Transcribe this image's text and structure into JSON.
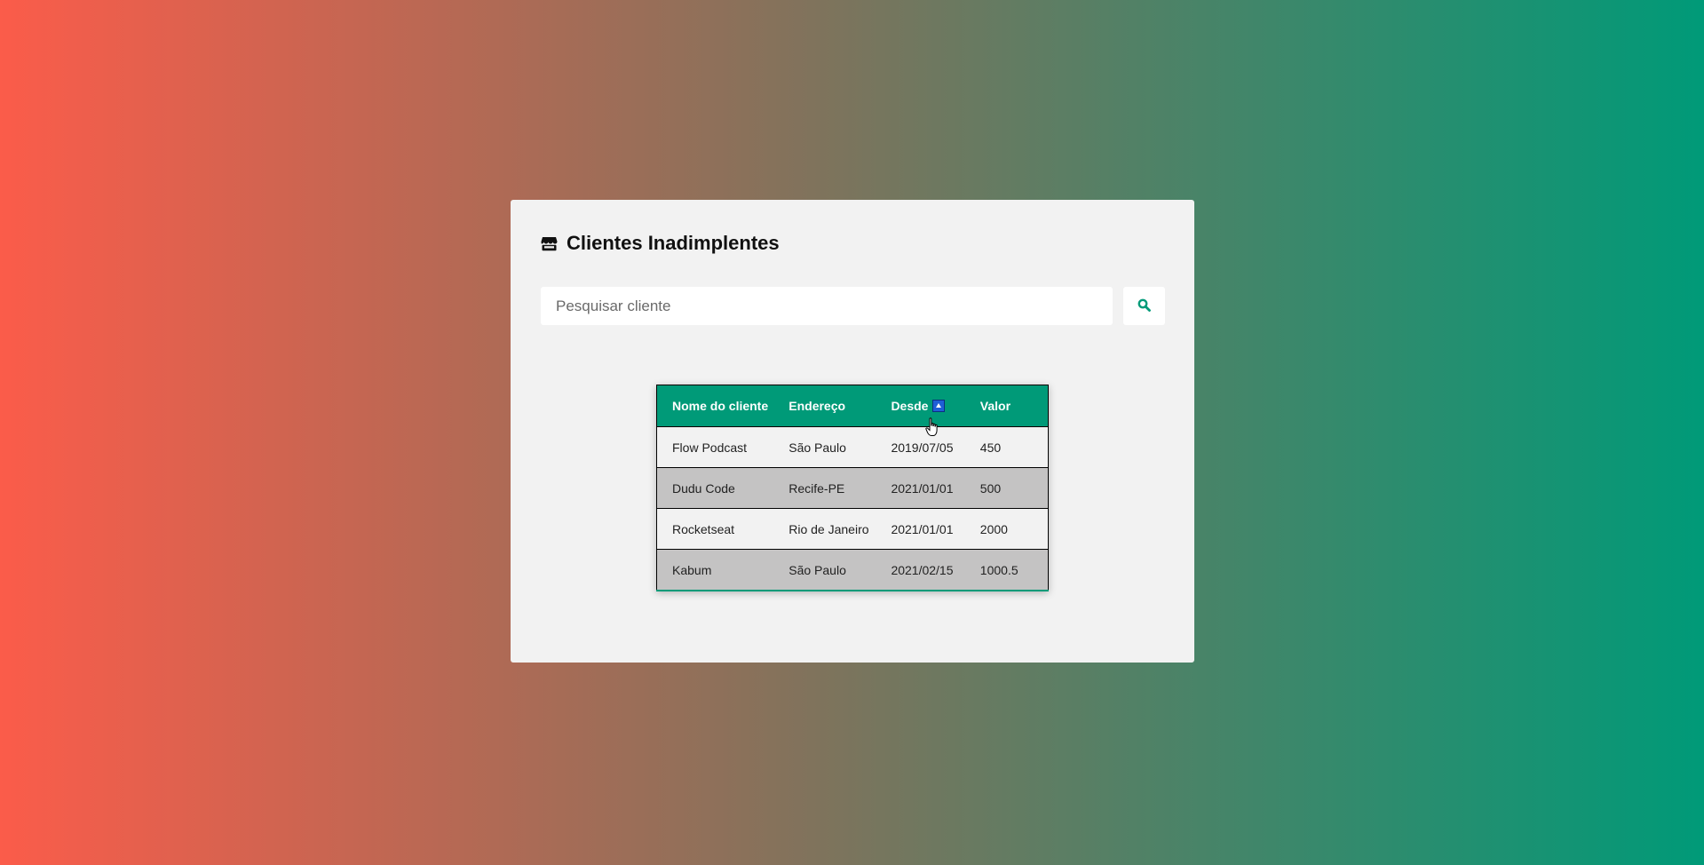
{
  "app": {
    "title": "Clientes Inadimplentes",
    "title_icon": "store-icon"
  },
  "search": {
    "placeholder": "Pesquisar cliente",
    "value": "",
    "button_icon": "search-icon"
  },
  "table": {
    "columns": [
      {
        "label": "Nome do cliente",
        "sorted": false
      },
      {
        "label": "Endereço",
        "sorted": false
      },
      {
        "label": "Desde",
        "sorted": true,
        "sort_direction": "ascending"
      },
      {
        "label": "Valor",
        "sorted": false
      }
    ],
    "rows": [
      [
        "Flow Podcast",
        "São Paulo",
        "2019/07/05",
        "450"
      ],
      [
        "Dudu Code",
        "Recife-PE",
        "2021/01/01",
        "500"
      ],
      [
        "Rocketseat",
        "Rio de Janeiro",
        "2021/01/01",
        "2000"
      ],
      [
        "Kabum",
        "São Paulo",
        "2021/02/15",
        "1000.5"
      ]
    ]
  },
  "colors": {
    "accent": "#009a78",
    "gradient_start": "#fb5c4a",
    "gradient_end": "#009a78",
    "card_background": "#f2f2f2",
    "row_alt": "#c4c3c3",
    "sort_indicator": "#1f5fd6"
  }
}
